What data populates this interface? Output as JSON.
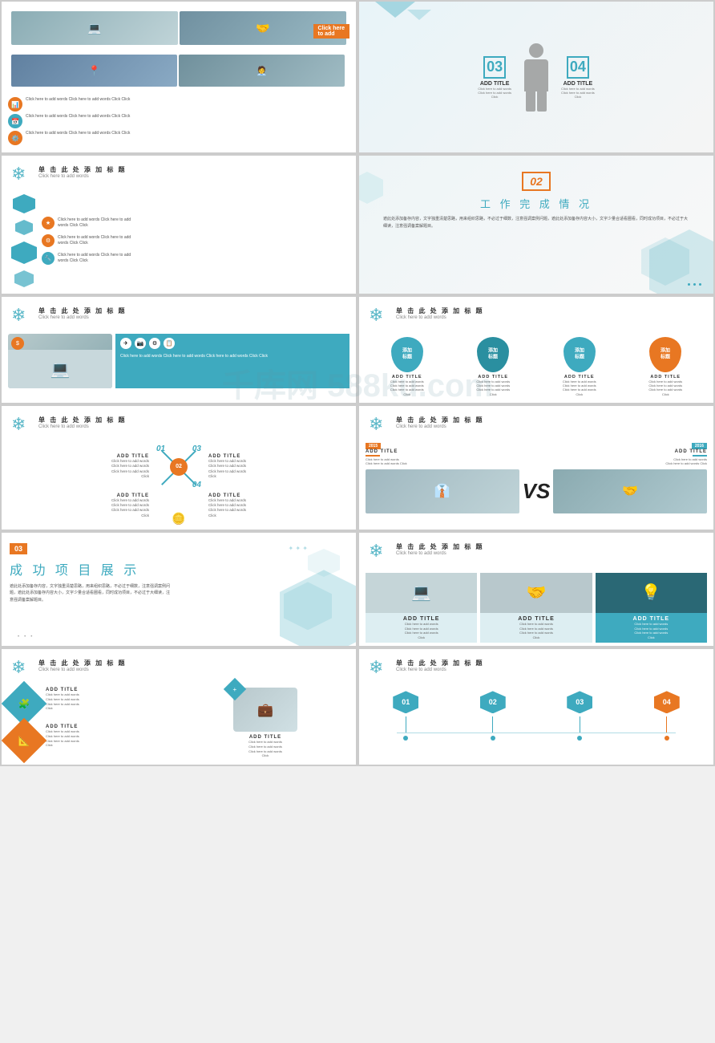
{
  "watermark": "千库网 588ku.com",
  "slides": [
    {
      "id": "slide-top-row1-left",
      "type": "image-list",
      "items": [
        {
          "icon": "📊",
          "text": "Click here to add words Click here to add words Click Click"
        },
        {
          "icon": "📅",
          "text": "Click here to add words Click here to add words Click Click"
        },
        {
          "icon": "⚙️",
          "text": "Click here to add words Click here to add words Click Click"
        }
      ]
    },
    {
      "id": "slide-top-row1-right",
      "type": "person-stats",
      "items": [
        {
          "num": "03",
          "title": "ADD TITLE",
          "text": "Click here to add words\nClick here to add words\nClick"
        },
        {
          "num": "04",
          "title": "ADD TITLE",
          "text": "Click here to add words\nClick here to add words\nClick"
        }
      ]
    },
    {
      "id": "slide2-left",
      "type": "hexagon-list",
      "header": {
        "cn": "单 击 此 处 添 加 标 题",
        "en": "Click here to add words"
      },
      "items": [
        {
          "text": "Click here to add words Click here to add words Click Click"
        },
        {
          "text": "Click here to add words Click here to add words Click Click"
        },
        {
          "text": "Click here to add words Click here to add words Click Click"
        }
      ]
    },
    {
      "id": "slide2-right",
      "type": "work-completion",
      "number": "02",
      "title": "工 作 完 成 情 况",
      "text": "遮此处添加备存内容，文字独重清楚思路，用来组织思路，不必过于细数，注意强调案例问题，遮此处添加备存内容大小，文字少量合适看圈看，同时成功项目，不必过于大细读，注意强调备案解题目。"
    },
    {
      "id": "slide3-left",
      "type": "laptop-icons",
      "header": {
        "cn": "单 击 此 处 添 加 标 题",
        "en": "Click here to add words"
      },
      "icons": [
        "✈",
        "📷",
        "⚙",
        "📋"
      ],
      "text": "Click here to add words Click here to add words Click here to add words Click Click"
    },
    {
      "id": "slide3-right",
      "type": "water-drops",
      "header": {
        "cn": "单 击 此 处 添 加 标 题",
        "en": "Click here to add words"
      },
      "items": [
        {
          "label": "ADD TITLE",
          "cn": "添加\n标题",
          "sub": "Click here to add words\nClick here to add words\nClick here to add words\nClick"
        },
        {
          "label": "ADD TITLE",
          "cn": "添加\n标题",
          "sub": "Click here to add words\nClick here to add words\nClick here to add words\nClick"
        },
        {
          "label": "ADD TITLE",
          "cn": "添加\n标题",
          "sub": "Click here to add words\nClick here to add words\nClick here to add words\nClick"
        },
        {
          "label": "ADD TITLE",
          "cn": "添加\n标题",
          "sub": "Click here to add words\nClick here to add words\nClick here to add words\nClick"
        }
      ]
    },
    {
      "id": "slide4-left",
      "type": "cross-diagram",
      "header": {
        "cn": "单 击 此 处 添 加 标 题",
        "en": "Click here to add words"
      },
      "items": [
        {
          "num": "01",
          "title": "ADD TITLE",
          "text": "Click here to add words\nClick here to add words\nClick here to add words\nClick"
        },
        {
          "num": "02",
          "title": "ADD TITLE",
          "text": "Click here to add words\nClick here to add words\nClick here to add words\nClick"
        },
        {
          "num": "03",
          "title": "ADD TITLE",
          "text": "Click here to add words\nClick here to add words\nClick here to add words\nClick"
        },
        {
          "num": "04",
          "title": "ADD TITLE",
          "text": "Click here to add words\nClick here to add words\nClick here to add words\nClick"
        }
      ]
    },
    {
      "id": "slide4-right",
      "type": "vs-comparison",
      "header": {
        "cn": "单 击 此 处 添 加 标 题",
        "en": "Click here to add words"
      },
      "year_left": "2015",
      "year_right": "2016",
      "left_title": "ADD TITLE",
      "right_title": "ADD TITLE",
      "vs": "VS",
      "left_text": "Click here to add words Click here to add words Click",
      "right_text": "Click here to add words Click here to add words Click"
    },
    {
      "id": "slide5-left",
      "type": "project-showcase",
      "number": "03",
      "title": "成 功 项 目 展 示",
      "text": "遮此处添加备存内容，文字独重清楚思路，用来组织思路，不必过于细数，注意强调案例问题，遮此处添加备存内容大小，文字少量合适看圈看，同时成功项目，不必过于大细读，注意强调备案解题目。"
    },
    {
      "id": "slide5-right",
      "type": "photo-cards",
      "header": {
        "cn": "单 击 此 处 添 加 标 题",
        "en": "Click here to add words"
      },
      "cards": [
        {
          "title": "ADD TITLE",
          "text": "Click here to add words\nClick here to add words\nClick here to add words\nClick",
          "style": "laptop"
        },
        {
          "title": "ADD TITLE",
          "text": "Click here to add words\nClick here to add words\nClick here to add words\nClick",
          "style": "hands"
        },
        {
          "title": "ADD TITLE",
          "text": "Click here to add words\nClick here to add words\nClick here to add words\nClick",
          "style": "tech"
        }
      ]
    },
    {
      "id": "slide6-left",
      "type": "puzzle-diamond",
      "header": {
        "cn": "单 击 此 处 添 加 标 题",
        "en": "Click here to add words"
      },
      "items": [
        {
          "title": "ADD TITLE",
          "text": "Click here to add words\nClick here to add words\nClick here to add words\nClick",
          "color": "teal",
          "icon": "🧩"
        },
        {
          "title": "ADD TITLE",
          "text": "Click here to add words\nClick here to add words\nClick here to add words\nClick",
          "color": "orange",
          "icon": "📐"
        },
        {
          "title": "ADD TITLE",
          "text": "Click here to add words\nClick here to add words\nClick here to add words\nClick",
          "color": "teal",
          "icon": "🔷"
        }
      ]
    },
    {
      "id": "slide6-right",
      "type": "hex-timeline",
      "header": {
        "cn": "单 击 此 处 添 加 标 题",
        "en": "Click here to add words"
      },
      "items": [
        {
          "num": "01",
          "color": "teal"
        },
        {
          "num": "02",
          "color": "teal"
        },
        {
          "num": "03",
          "color": "teal"
        },
        {
          "num": "04",
          "color": "orange"
        }
      ]
    }
  ]
}
